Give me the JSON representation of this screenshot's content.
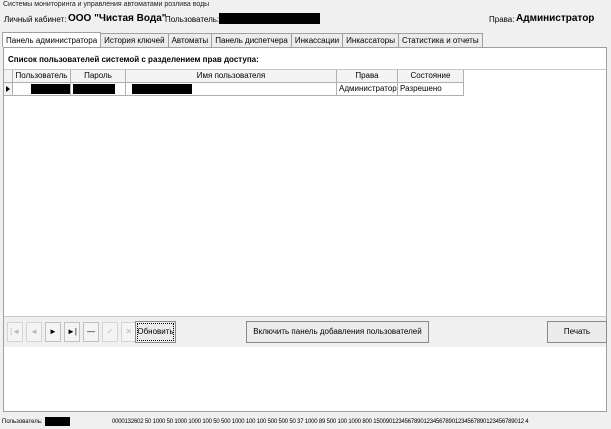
{
  "window": {
    "title": "Системы мониторинга и управления автоматами розлива воды"
  },
  "header": {
    "cabinet_label": "Личный кабинет:",
    "org_name": "ООО \"Чистая Вода\"",
    "user_label": "Пользователь:",
    "rights_label": "Права:",
    "rights_value": "Администратор"
  },
  "tabs": [
    {
      "label": "Панель администратора",
      "active": true
    },
    {
      "label": "История ключей",
      "active": false
    },
    {
      "label": "Автоматы",
      "active": false
    },
    {
      "label": "Панель диспетчера",
      "active": false
    },
    {
      "label": "Инкассации",
      "active": false
    },
    {
      "label": "Инкассаторы",
      "active": false
    },
    {
      "label": "Статистика и отчеты",
      "active": false
    }
  ],
  "admin_panel": {
    "section_title": "Список пользователей системой с разделением прав доступа:",
    "table": {
      "columns": [
        "Пользователь",
        "Пароль",
        "Имя пользователя",
        "Права",
        "Состояние"
      ],
      "rows": [
        {
          "user": "",
          "password": "",
          "name": "",
          "rights": "Администратор",
          "state": "Разрешено"
        }
      ]
    },
    "navigator": {
      "buttons": [
        {
          "name": "first-record",
          "glyph": "|◄",
          "enabled": false
        },
        {
          "name": "prior-record",
          "glyph": "◄",
          "enabled": false
        },
        {
          "name": "next-record",
          "glyph": "►",
          "enabled": true
        },
        {
          "name": "last-record",
          "glyph": "►|",
          "enabled": true
        },
        {
          "name": "delete-record",
          "glyph": "—",
          "enabled": true
        },
        {
          "name": "post-edit",
          "glyph": "✓",
          "enabled": false
        },
        {
          "name": "cancel-edit",
          "glyph": "✕",
          "enabled": false
        }
      ],
      "refresh_label": "Обновить"
    },
    "add_panel_button": "Включить панель добавления пользователей",
    "print_button": "Печать"
  },
  "statusbar": {
    "user_label": "Пользователь:",
    "codes": "0000132602  50 1000  50 1000 1000  100  50  500 1000  100  100  500  500   50   37   1000 89   500  100 1000  800 150090123456789012345678901234567890123456789012 4"
  },
  "colors": {
    "window_bg": "#f0f0f0",
    "panel_bg": "#ffffff",
    "redaction": "#000000"
  }
}
